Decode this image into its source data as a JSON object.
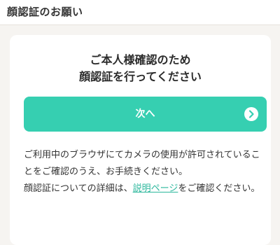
{
  "header": {
    "title": "顔認証のお願い"
  },
  "main": {
    "heading_line1": "ご本人様確認のため",
    "heading_line2": "顔認証を行ってください",
    "next_button": {
      "label": "次へ",
      "icon": "chevron-right-icon"
    },
    "paragraph1": "ご利用中のブラウザにてカメラの使用が許可されていることをご確認のうえ、お手続きください。",
    "paragraph2_before": "顔認証についての詳細は、",
    "paragraph2_link": "説明ページ",
    "paragraph2_after": "をご確認ください。"
  },
  "colors": {
    "accent": "#36cfb1",
    "link": "#2bb79c",
    "background": "#f6f4f1"
  }
}
